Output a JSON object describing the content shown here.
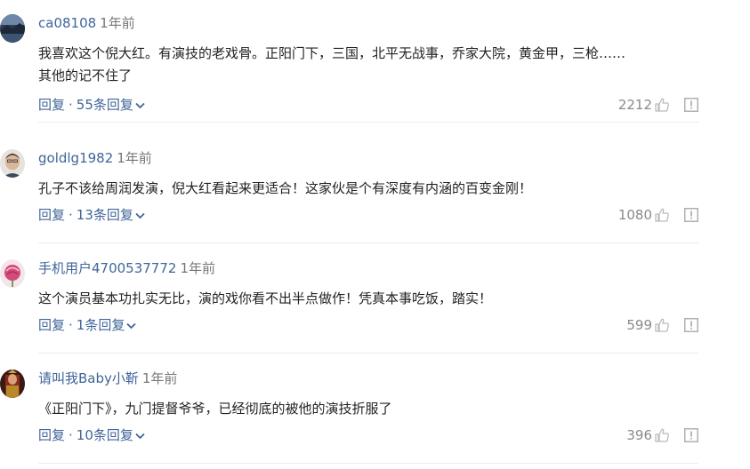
{
  "comments": [
    {
      "username": "ca08108",
      "time": "1年前",
      "text_lines": [
        "我喜欢这个倪大红。有演技的老戏骨。正阳门下，三国，北平无战事，乔家大院，黄金甲，三枪……",
        "其他的记不住了"
      ],
      "reply_label": "回复",
      "sep": "·",
      "replies_label": "55条回复",
      "likes": "2212",
      "avatar_icon": "landscape-avatar"
    },
    {
      "username": "goldlg1982",
      "time": "1年前",
      "text_lines": [
        "孔子不该给周润发演，倪大红看起来更适合！这家伙是个有深度有内涵的百变金刚！"
      ],
      "reply_label": "回复",
      "sep": "·",
      "replies_label": "13条回复",
      "likes": "1080",
      "avatar_icon": "person-avatar"
    },
    {
      "username": "手机用户4700537772",
      "time": "1年前",
      "text_lines": [
        "这个演员基本功扎实无比，演的戏你看不出半点做作！凭真本事吃饭，踏实！"
      ],
      "reply_label": "回复",
      "sep": "·",
      "replies_label": "1条回复",
      "likes": "599",
      "avatar_icon": "flower-avatar"
    },
    {
      "username": "请叫我Baby小靳",
      "time": "1年前",
      "text_lines": [
        "《正阳门下》，九门提督爷爷，已经彻底的被他的演技折服了"
      ],
      "reply_label": "回复",
      "sep": "·",
      "replies_label": "10条回复",
      "likes": "396",
      "avatar_icon": "costume-avatar"
    }
  ],
  "colors": {
    "link": "#406599",
    "text": "#222222",
    "muted": "#8a8a8a",
    "divider": "#ececec"
  }
}
